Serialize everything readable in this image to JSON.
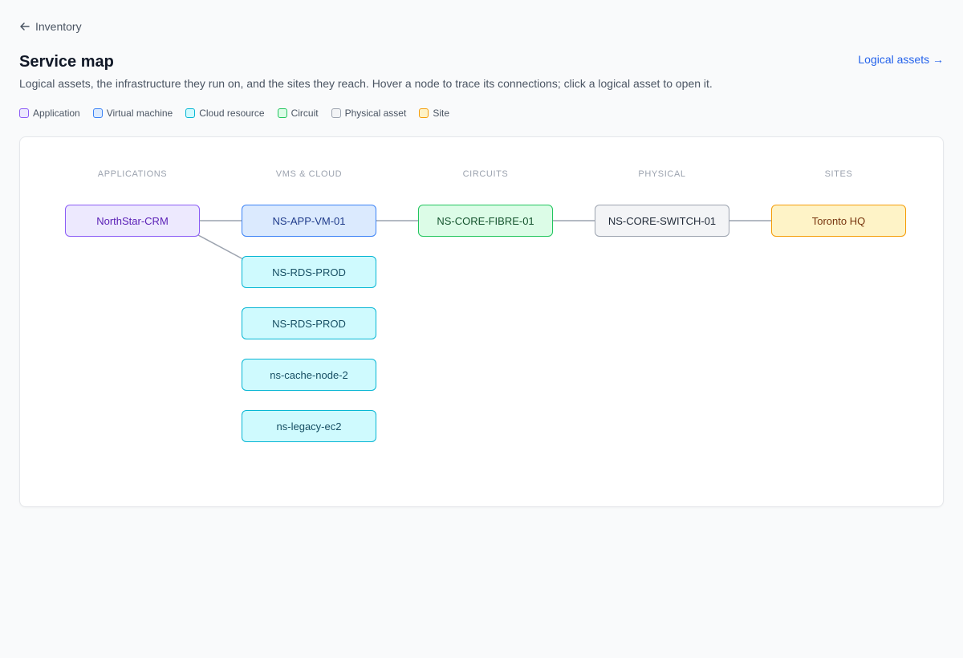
{
  "header": {
    "back_label": "Inventory",
    "title": "Service map",
    "subtitle": "Logical assets, the infrastructure they run on, and the sites they reach. Hover a node to trace its connections; click a logical asset to open it.",
    "logical_assets_link": "Logical assets →"
  },
  "legend": [
    {
      "label": "Application",
      "color": "#8b5cf6",
      "fill": "#ede9fe"
    },
    {
      "label": "Virtual machine",
      "color": "#3b82f6",
      "fill": "#dbeafe"
    },
    {
      "label": "Cloud resource",
      "color": "#06b6d4",
      "fill": "#cffafe"
    },
    {
      "label": "Circuit",
      "color": "#22c55e",
      "fill": "#dcfce7"
    },
    {
      "label": "Physical asset",
      "color": "#9ca3af",
      "fill": "#f3f4f6"
    },
    {
      "label": "Site",
      "color": "#f59e0b",
      "fill": "#fef3c7"
    }
  ],
  "columns": [
    "APPLICATIONS",
    "VMS & CLOUD",
    "CIRCUITS",
    "PHYSICAL",
    "SITES"
  ],
  "nodes": {
    "app_northstar": "NorthStar-CRM",
    "vm_app01": "NS-APP-VM-01",
    "cloud_rds_1": "NS-RDS-PROD",
    "cloud_rds_2": "NS-RDS-PROD",
    "cloud_cache": "ns-cache-node-2",
    "cloud_legacy": "ns-legacy-ec2",
    "circuit_fibre": "NS-CORE-FIBRE-01",
    "phys_switch": "NS-CORE-SWITCH-01",
    "site_toronto": "Toronto HQ"
  },
  "icons": {
    "back": "arrow-left-icon"
  }
}
